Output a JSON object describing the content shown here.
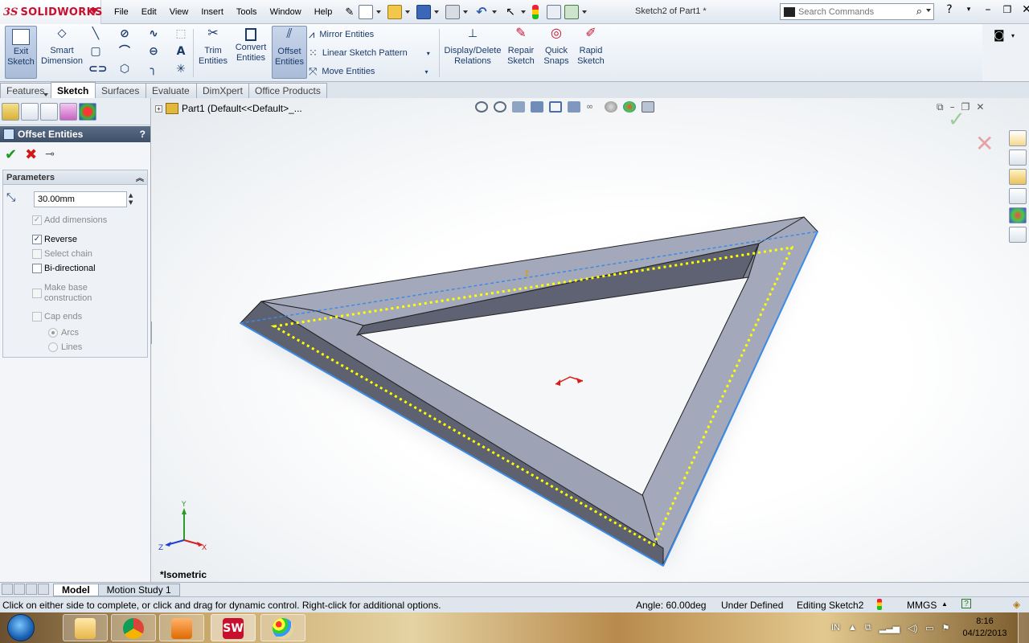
{
  "app": {
    "logo_ds": "3S",
    "logo_name": "SOLIDWORKS",
    "document_title": "Sketch2 of Part1 *"
  },
  "menu": [
    "File",
    "Edit",
    "View",
    "Insert",
    "Tools",
    "Window",
    "Help"
  ],
  "search": {
    "placeholder": "Search Commands"
  },
  "ribbon": {
    "exit_sketch": [
      "Exit",
      "Sketch"
    ],
    "smart_dimension": [
      "Smart",
      "Dimension"
    ],
    "trim_entities": [
      "Trim",
      "Entities"
    ],
    "convert_entities": [
      "Convert",
      "Entities"
    ],
    "offset_entities": [
      "Offset",
      "Entities"
    ],
    "mirror_entities": "Mirror Entities",
    "linear_sketch_pattern": "Linear Sketch Pattern",
    "move_entities": "Move Entities",
    "display_delete_relations": [
      "Display/Delete",
      "Relations"
    ],
    "repair_sketch": [
      "Repair",
      "Sketch"
    ],
    "quick_snaps": [
      "Quick",
      "Snaps"
    ],
    "rapid_sketch": [
      "Rapid",
      "Sketch"
    ]
  },
  "tabs": [
    "Features",
    "Sketch",
    "Surfaces",
    "Evaluate",
    "DimXpert",
    "Office Products"
  ],
  "active_tab": "Sketch",
  "property_manager": {
    "title": "Offset Entities",
    "help": "?",
    "parameters_label": "Parameters",
    "distance_value": "30.00mm",
    "options": [
      {
        "label": "Add dimensions",
        "checked": true,
        "enabled": false
      },
      {
        "label": "Reverse",
        "checked": true,
        "enabled": true
      },
      {
        "label": "Select chain",
        "checked": false,
        "enabled": false
      },
      {
        "label": "Bi-directional",
        "checked": false,
        "enabled": true
      },
      {
        "label": "Make base construction",
        "checked": false,
        "enabled": false
      },
      {
        "label": "Cap ends",
        "checked": false,
        "enabled": false
      }
    ],
    "make_base_line1": "Make base",
    "make_base_line2": "construction",
    "cap_options": [
      {
        "label": "Arcs",
        "selected": true
      },
      {
        "label": "Lines",
        "selected": false
      }
    ]
  },
  "tree": {
    "root_label": "Part1  (Default<<Default>_..."
  },
  "view": {
    "orientation_label": "*Isometric",
    "triad_axes": [
      "Y",
      "Z",
      "X"
    ]
  },
  "model_tabs": [
    "Model",
    "Motion Study 1"
  ],
  "status_bar": {
    "message": "Click on either side to complete, or click and drag for dynamic control.  Right-click for additional options.",
    "angle": "Angle: 60.00deg",
    "state": "Under Defined",
    "editing": "Editing Sketch2",
    "units": "MMGS",
    "units_caret": "▲",
    "help_icon": "?"
  },
  "taskbar": {
    "language": "IN",
    "time": "8:16",
    "date": "04/12/2013"
  },
  "colors": {
    "brand": "#c8102e",
    "selection_blue": "#3c8ce6",
    "preview_yellow": "#ffff00",
    "solid_face": "#9da2b4",
    "solid_side": "#5d6170"
  }
}
